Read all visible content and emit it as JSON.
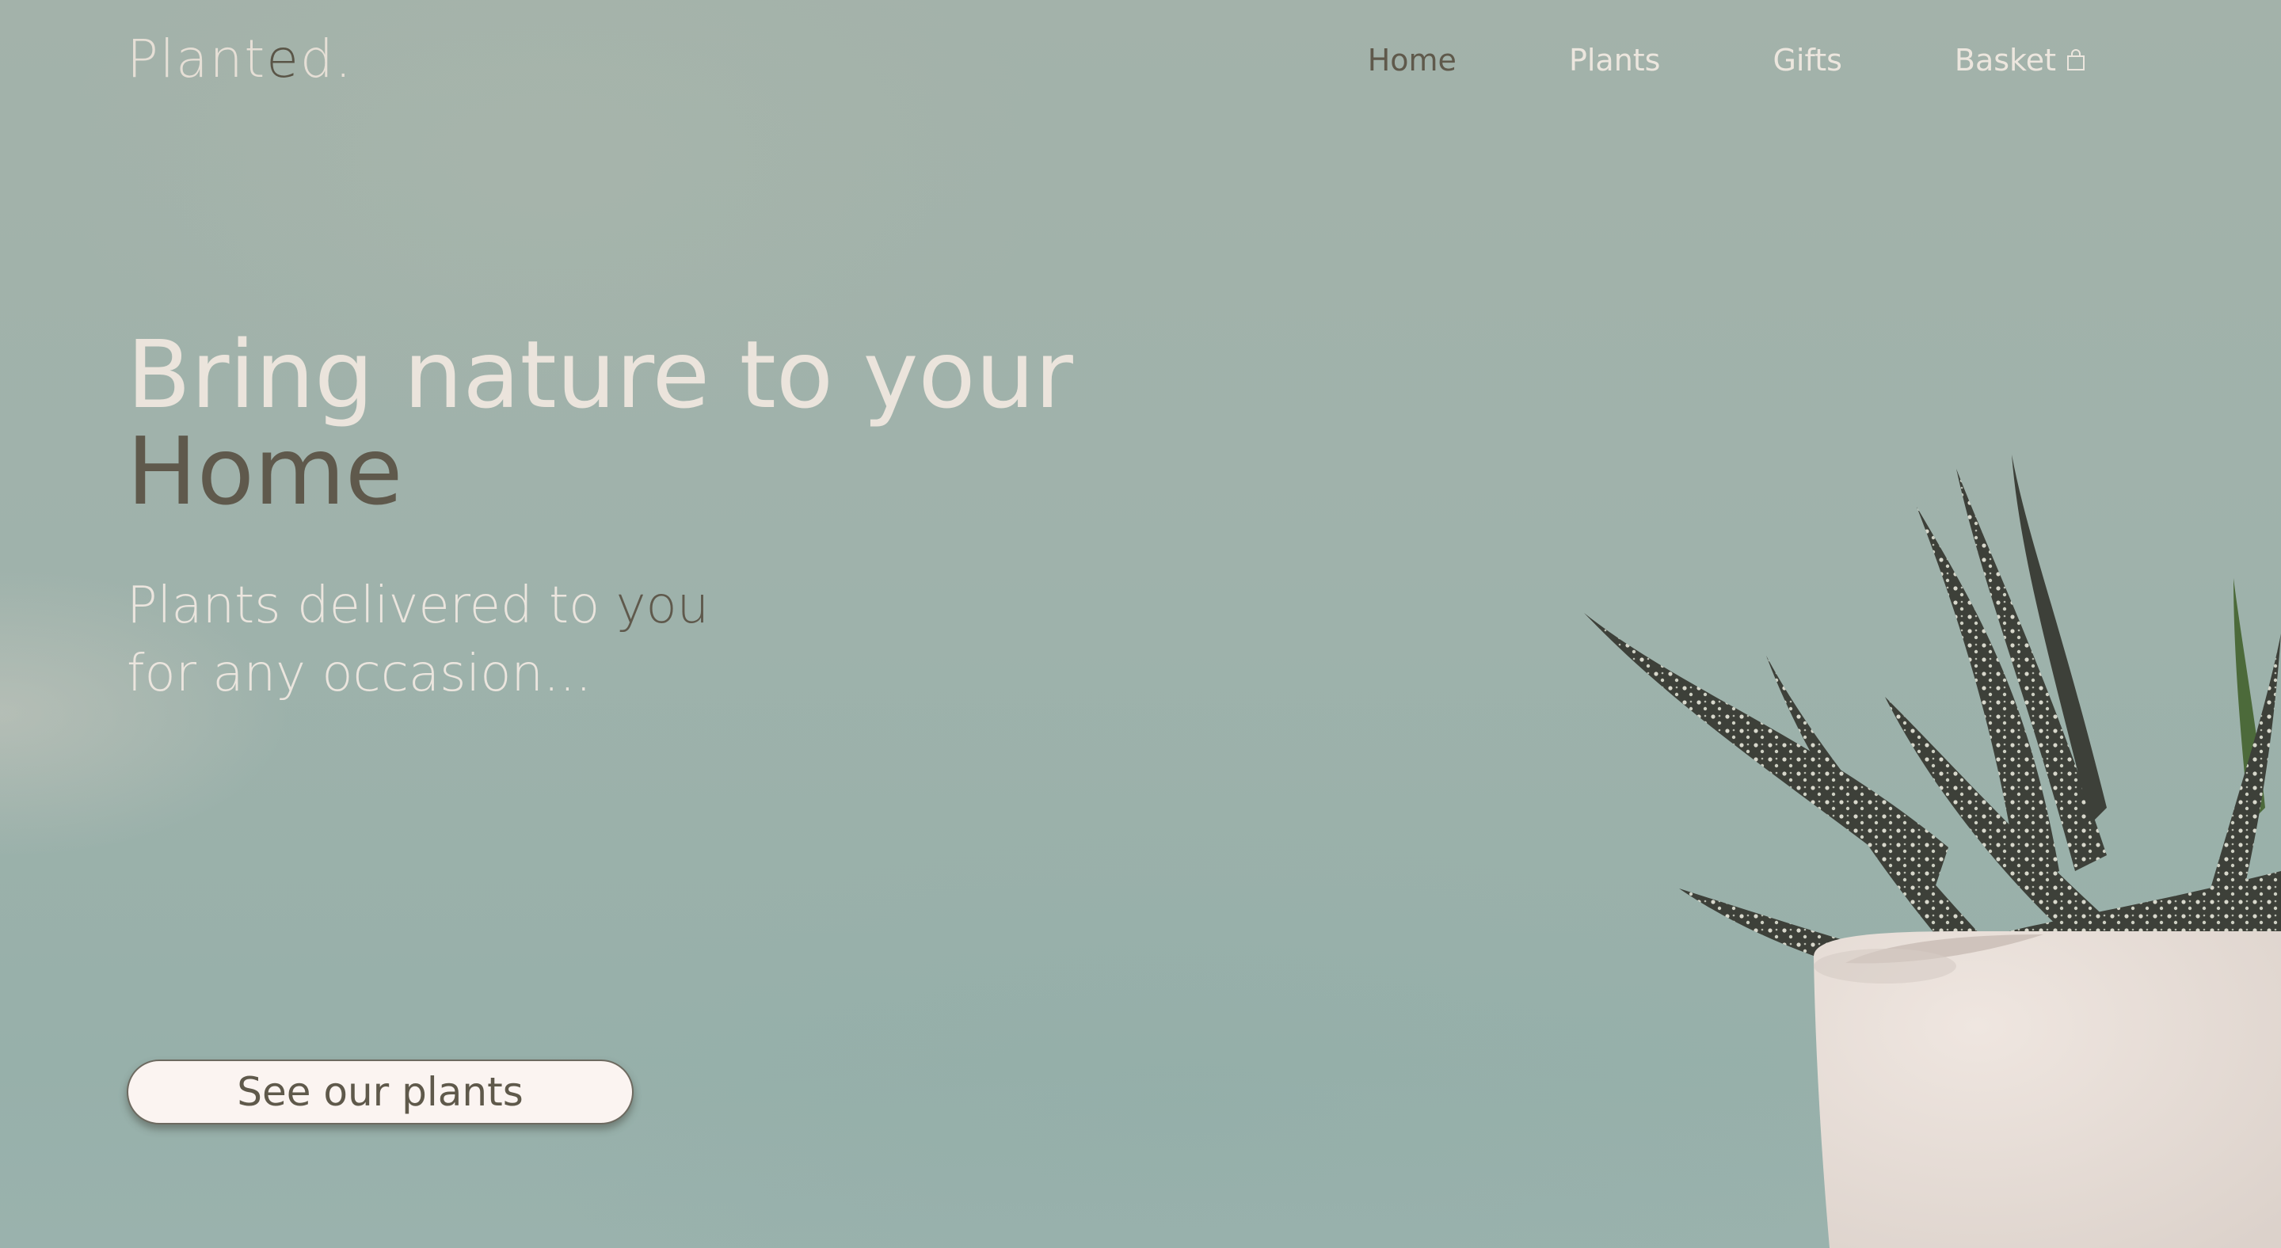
{
  "brand": {
    "logo_light": "Plant",
    "logo_dark": "e",
    "logo_light2": "d."
  },
  "nav": {
    "items": [
      {
        "label": "Home",
        "active": true
      },
      {
        "label": "Plants",
        "active": false
      },
      {
        "label": "Gifts",
        "active": false
      },
      {
        "label": "Basket",
        "active": false,
        "icon": "shopping-bag-icon"
      }
    ]
  },
  "hero": {
    "title_line1": "Bring nature to your",
    "title_line2": "Home",
    "subtitle_part1": "Plants delivered to ",
    "subtitle_part1_dark": "you",
    "subtitle_line2": "for any occasion..."
  },
  "cta": {
    "label": "See our plants"
  },
  "colors": {
    "background": "#9fb2ab",
    "light_text": "#ebe4dc",
    "dark_text": "#5f594c",
    "button_bg": "#fbf4f1"
  },
  "images": {
    "hero_plant": "potted-aloe-succulent"
  }
}
